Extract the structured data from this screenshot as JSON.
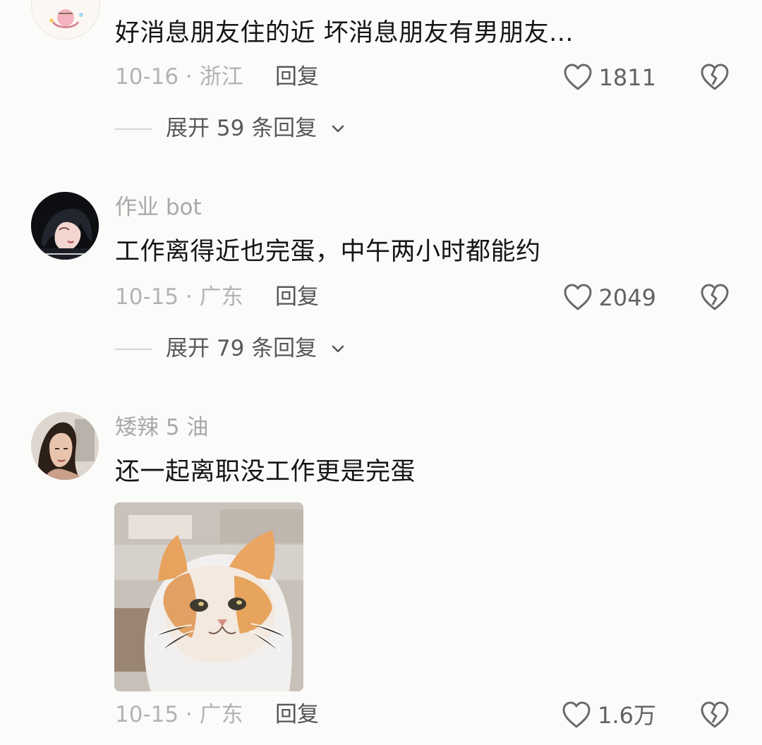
{
  "comments": [
    {
      "text": "好消息朋友住的近 坏消息朋友有男朋友...",
      "date_location": "10-16 · 浙江",
      "reply_label": "回复",
      "likes": "1811",
      "expand_label": "展开 59 条回复"
    },
    {
      "username": "作业 bot",
      "text": "工作离得近也完蛋，中午两小时都能约",
      "date_location": "10-15 · 广东",
      "reply_label": "回复",
      "likes": "2049",
      "expand_label": "展开 79 条回复"
    },
    {
      "username": "矮辣 5 油",
      "text": "还一起离职没工作更是完蛋",
      "date_location": "10-15 · 广东",
      "reply_label": "回复",
      "likes": "1.6万"
    }
  ],
  "icons": {
    "like": "heart-outline-icon",
    "dislike": "broken-heart-icon",
    "expand": "chevron-down-icon"
  },
  "colors": {
    "background": "#fbfbf9",
    "text_primary": "#151515",
    "text_secondary": "#a9a9a9",
    "like_count": "#626262"
  }
}
